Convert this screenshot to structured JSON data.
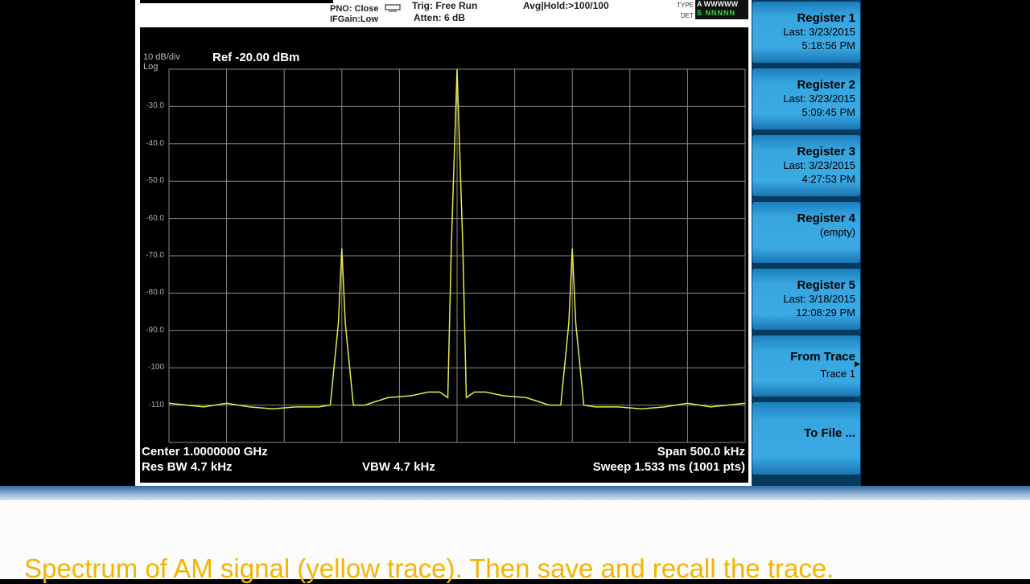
{
  "analyzer": {
    "pno": "PNO: Close",
    "ifgain": "IFGain:Low",
    "trig": "Trig: Free Run",
    "atten": "Atten: 6 dB",
    "avg": "Avg|Hold:>100/100",
    "type_label": "TYPE",
    "det_label": "DET",
    "trace_type": "A WWWWW",
    "trace_det": "S NNNNN",
    "scale": "10 dB/div",
    "scale_mode": "Log",
    "ref": "Ref -20.00 dBm",
    "yticks": [
      "-30.0",
      "-40.0",
      "-50.0",
      "-60.0",
      "-70.0",
      "-80.0",
      "-90.0",
      "-100",
      "-110"
    ],
    "center": "Center 1.0000000 GHz",
    "res_bw": "Res BW 4.7 kHz",
    "vbw": "VBW 4.7 kHz",
    "span": "Span 500.0 kHz",
    "sweep": "Sweep  1.533 ms (1001 pts)"
  },
  "softkeys": [
    {
      "title": "Register 1",
      "line1": "Last: 3/23/2015",
      "line2": "5:18:56 PM"
    },
    {
      "title": "Register 2",
      "line1": "Last: 3/23/2015",
      "line2": "5:09:45 PM"
    },
    {
      "title": "Register 3",
      "line1": "Last: 3/23/2015",
      "line2": "4:27:53 PM"
    },
    {
      "title": "Register 4",
      "line1": "(empty)",
      "line2": ""
    },
    {
      "title": "Register 5",
      "line1": "Last: 3/18/2015",
      "line2": "12:08:29 PM"
    },
    {
      "title": "From Trace",
      "line1": "Trace 1",
      "line2": ""
    },
    {
      "title": "To File ...",
      "line1": "",
      "line2": ""
    }
  ],
  "caption": "Spectrum of AM signal (yellow trace). Then save and recall the trace.",
  "chart_data": {
    "type": "line",
    "title": "",
    "xlabel": "",
    "ylabel": "",
    "x_unit": "kHz offset from center",
    "xlim": [
      -250,
      250
    ],
    "ylim": [
      -120,
      -20
    ],
    "grid": true,
    "trace_color": "#e8e84a",
    "series": [
      {
        "x": [
          -250,
          -220,
          -200,
          -180,
          -160,
          -140,
          -120,
          -110,
          -103,
          -100,
          -97,
          -90,
          -80,
          -60,
          -40,
          -25,
          -15,
          -8,
          -5,
          0,
          5,
          8,
          15,
          25,
          40,
          60,
          80,
          90,
          97,
          100,
          103,
          110,
          120,
          140,
          160,
          180,
          200,
          220,
          250
        ],
        "y": [
          -109.5,
          -110.5,
          -109.5,
          -110.5,
          -111,
          -110.5,
          -110.5,
          -110,
          -88,
          -68,
          -88,
          -110,
          -110,
          -108,
          -107.5,
          -106.5,
          -106.5,
          -108,
          -68,
          -20,
          -68,
          -108,
          -106.5,
          -106.5,
          -107.5,
          -108,
          -110,
          -110,
          -88,
          -68,
          -88,
          -110,
          -110.5,
          -110.5,
          -111,
          -110.5,
          -109.5,
          -110.5,
          -109.5
        ]
      }
    ]
  }
}
